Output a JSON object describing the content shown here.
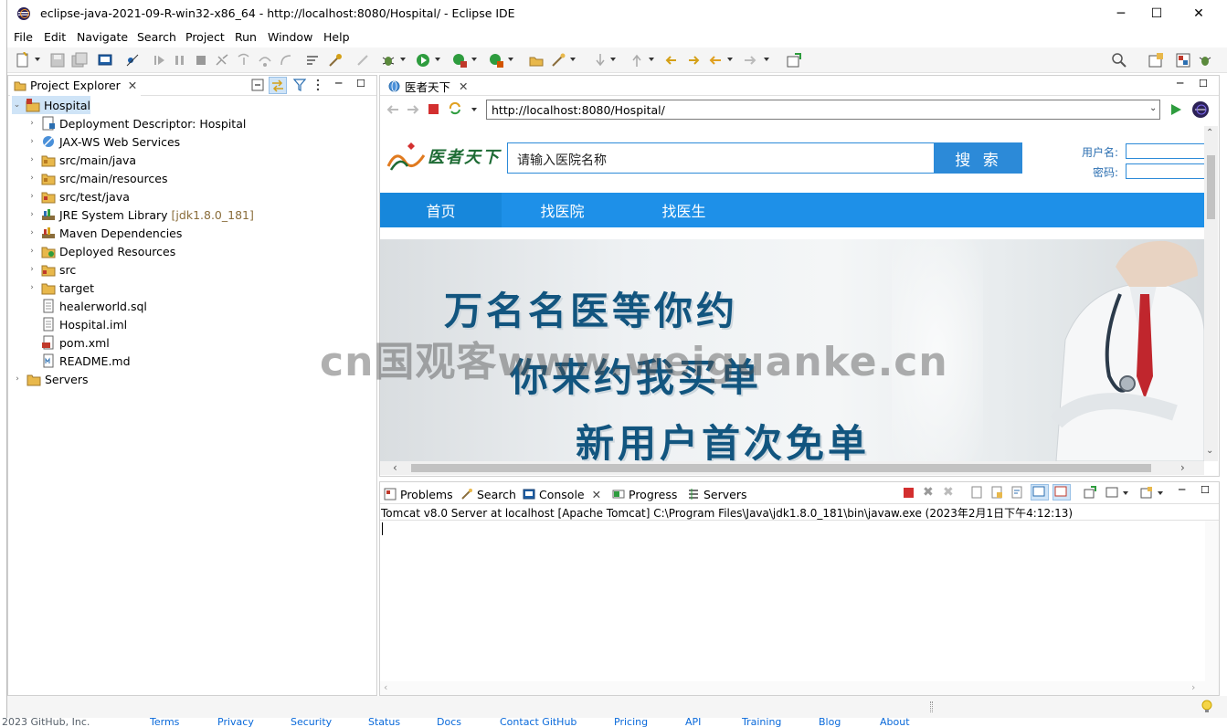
{
  "window": {
    "title": "eclipse-java-2021-09-R-win32-x86_64 - http://localhost:8080/Hospital/ - Eclipse IDE",
    "minimize": "─",
    "maximize": "☐",
    "close": "✕"
  },
  "menu": [
    "File",
    "Edit",
    "Navigate",
    "Search",
    "Project",
    "Run",
    "Window",
    "Help"
  ],
  "project_explorer": {
    "tab_label": "Project Explorer",
    "tree": [
      {
        "label": "Hospital",
        "level": 0,
        "expanded": true,
        "icon": "project-icon"
      },
      {
        "label": "Deployment Descriptor: Hospital",
        "level": 1,
        "icon": "deployment-descriptor-icon"
      },
      {
        "label": "JAX-WS Web Services",
        "level": 1,
        "icon": "web-services-icon"
      },
      {
        "label": "src/main/java",
        "level": 1,
        "icon": "source-folder-icon"
      },
      {
        "label": "src/main/resources",
        "level": 1,
        "icon": "source-folder-icon"
      },
      {
        "label": "src/test/java",
        "level": 1,
        "icon": "test-source-folder-icon"
      },
      {
        "label": "JRE System Library",
        "suffix": "[jdk1.8.0_181]",
        "level": 1,
        "icon": "library-icon"
      },
      {
        "label": "Maven Dependencies",
        "level": 1,
        "icon": "library-icon"
      },
      {
        "label": "Deployed Resources",
        "level": 1,
        "icon": "deployed-resources-icon"
      },
      {
        "label": "src",
        "level": 1,
        "icon": "folder-icon"
      },
      {
        "label": "target",
        "level": 1,
        "icon": "folder-icon"
      },
      {
        "label": "healerworld.sql",
        "level": 1,
        "leaf": true,
        "icon": "file-icon"
      },
      {
        "label": "Hospital.iml",
        "level": 1,
        "leaf": true,
        "icon": "file-icon"
      },
      {
        "label": "pom.xml",
        "level": 1,
        "leaf": true,
        "icon": "xml-file-icon"
      },
      {
        "label": "README.md",
        "level": 1,
        "leaf": true,
        "icon": "markdown-file-icon"
      },
      {
        "label": "Servers",
        "level": 0,
        "icon": "folder-icon"
      }
    ]
  },
  "browser": {
    "tab_label": "医者天下",
    "url": "http://localhost:8080/Hospital/",
    "page": {
      "logo_text": "医者天下",
      "search_placeholder": "请输入医院名称",
      "search_button": "搜 索",
      "username_label": "用户名:",
      "password_label": "密码:",
      "nav": [
        "首页",
        "找医院",
        "找医生"
      ],
      "banner_lines": [
        "万名名医等你约",
        "你来约我买单",
        "新用户首次免单"
      ]
    }
  },
  "watermark": "cn国观客www.weiguanke.cn",
  "console": {
    "tabs": [
      "Problems",
      "Search",
      "Console",
      "Progress",
      "Servers"
    ],
    "active_tab": "Console",
    "info": "Tomcat v8.0 Server at localhost [Apache Tomcat] C:\\Program Files\\Java\\jdk1.8.0_181\\bin\\javaw.exe  (2023年2月1日下午4:12:13)"
  },
  "footer_links": [
    "2023 GitHub, Inc.",
    "Terms",
    "Privacy",
    "Security",
    "Status",
    "Docs",
    "Contact GitHub",
    "Pricing",
    "API",
    "Training",
    "Blog",
    "About"
  ],
  "colors": {
    "accent_blue": "#1e90e8",
    "banner_text": "#12557f"
  }
}
